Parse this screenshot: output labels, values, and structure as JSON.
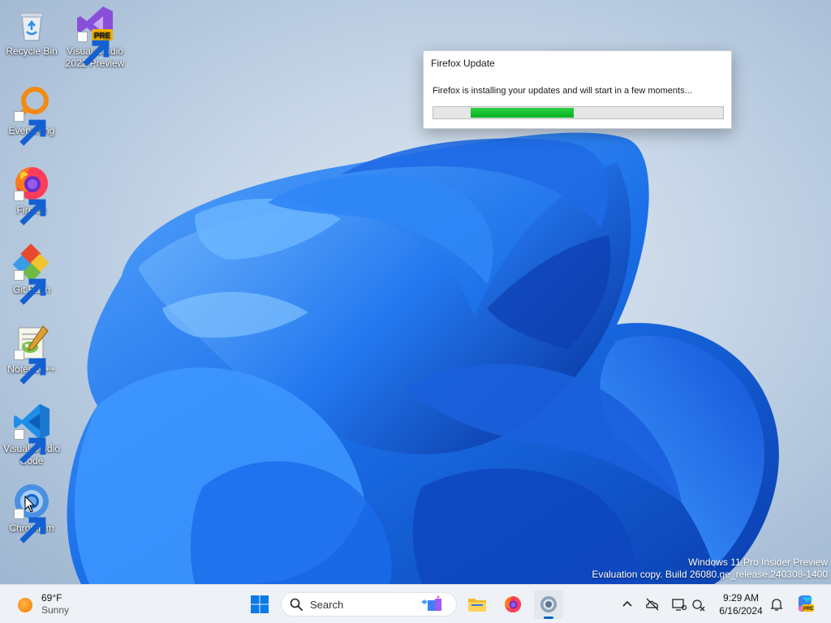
{
  "desktop": {
    "icons": [
      {
        "label": "Recycle Bin",
        "icon": "recycle-bin-icon"
      },
      {
        "label": "Visual Studio 2022 Preview",
        "icon": "visual-studio-preview-icon",
        "badge": "PRE"
      },
      {
        "label": "Everything",
        "icon": "everything-search-icon"
      },
      {
        "label": "Firefox",
        "icon": "firefox-icon"
      },
      {
        "label": "Git Bash",
        "icon": "git-bash-icon"
      },
      {
        "label": "Notepad++",
        "icon": "notepad-plus-plus-icon"
      },
      {
        "label": "Visual Studio Code",
        "icon": "vscode-icon"
      },
      {
        "label": "Chromium",
        "icon": "chromium-icon"
      }
    ]
  },
  "dialog": {
    "title": "Firefox Update",
    "message": "Firefox is installing your updates and will start in a few moments...",
    "progress_state": "indeterminate",
    "progress_color": "#06b025"
  },
  "watermark": {
    "line1": "Windows 11 Pro Insider Preview",
    "line2": "Evaluation copy. Build 26080.ge_release.240308-1400"
  },
  "taskbar": {
    "weather": {
      "temperature": "69°F",
      "condition": "Sunny",
      "icon": "sun-icon"
    },
    "search_placeholder": "Search",
    "pinned": [
      {
        "name": "start-button",
        "icon": "windows-start-icon"
      },
      {
        "name": "file-explorer",
        "icon": "folder-icon"
      },
      {
        "name": "firefox",
        "icon": "firefox-icon"
      },
      {
        "name": "chromium",
        "icon": "chromium-icon",
        "active": true
      }
    ],
    "tray": {
      "icons": [
        "chevron-up-icon",
        "onedrive-offline-icon",
        "display-icon",
        "network-icon",
        "notification-bell-icon",
        "copilot-icon"
      ],
      "time": "9:29 AM",
      "date": "6/16/2024"
    }
  },
  "colors": {
    "accent": "#0067c0",
    "taskbar_bg": "#eef1f6",
    "wallpaper_blue": "#1a6fe8"
  }
}
